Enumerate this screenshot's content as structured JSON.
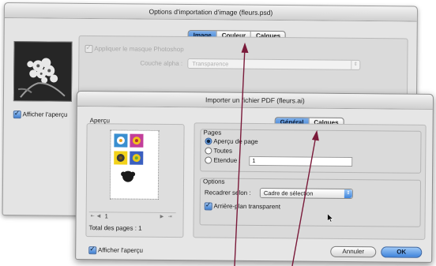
{
  "back_dialog": {
    "title": "Options d'importation d'image (fleurs.psd)",
    "tabs": [
      {
        "label": "Image",
        "selected": true
      },
      {
        "label": "Couleur",
        "selected": false
      },
      {
        "label": "Calques",
        "selected": false
      }
    ],
    "apply_mask_label": "Appliquer le masque Photoshop",
    "alpha_channel_label": "Couche alpha :",
    "alpha_channel_value": "Transparence",
    "show_preview_label": "Afficher l'aperçu"
  },
  "front_dialog": {
    "title": "Importer un fichier PDF (fleurs.ai)",
    "preview_group_label": "Aperçu",
    "tabs": [
      {
        "label": "Général",
        "selected": true
      },
      {
        "label": "Calques",
        "selected": false
      }
    ],
    "pages_group_label": "Pages",
    "pages_options": [
      {
        "label": "Aperçu de page",
        "selected": true
      },
      {
        "label": "Toutes",
        "selected": false
      },
      {
        "label": "Etendue :",
        "selected": false
      }
    ],
    "range_value": "1",
    "page_nav_value": "1",
    "total_pages_label": "Total des pages : 1",
    "options_group_label": "Options",
    "crop_label": "Recadrer selon :",
    "crop_value": "Cadre de sélection",
    "transparent_bg_label": "Arrière-plan transparent",
    "show_preview_label": "Afficher l'aperçu",
    "cancel_label": "Annuler",
    "ok_label": "OK"
  },
  "colors": {
    "accent_blue": "#3d7fd3",
    "annotation_arrow": "#7a1a3a"
  }
}
